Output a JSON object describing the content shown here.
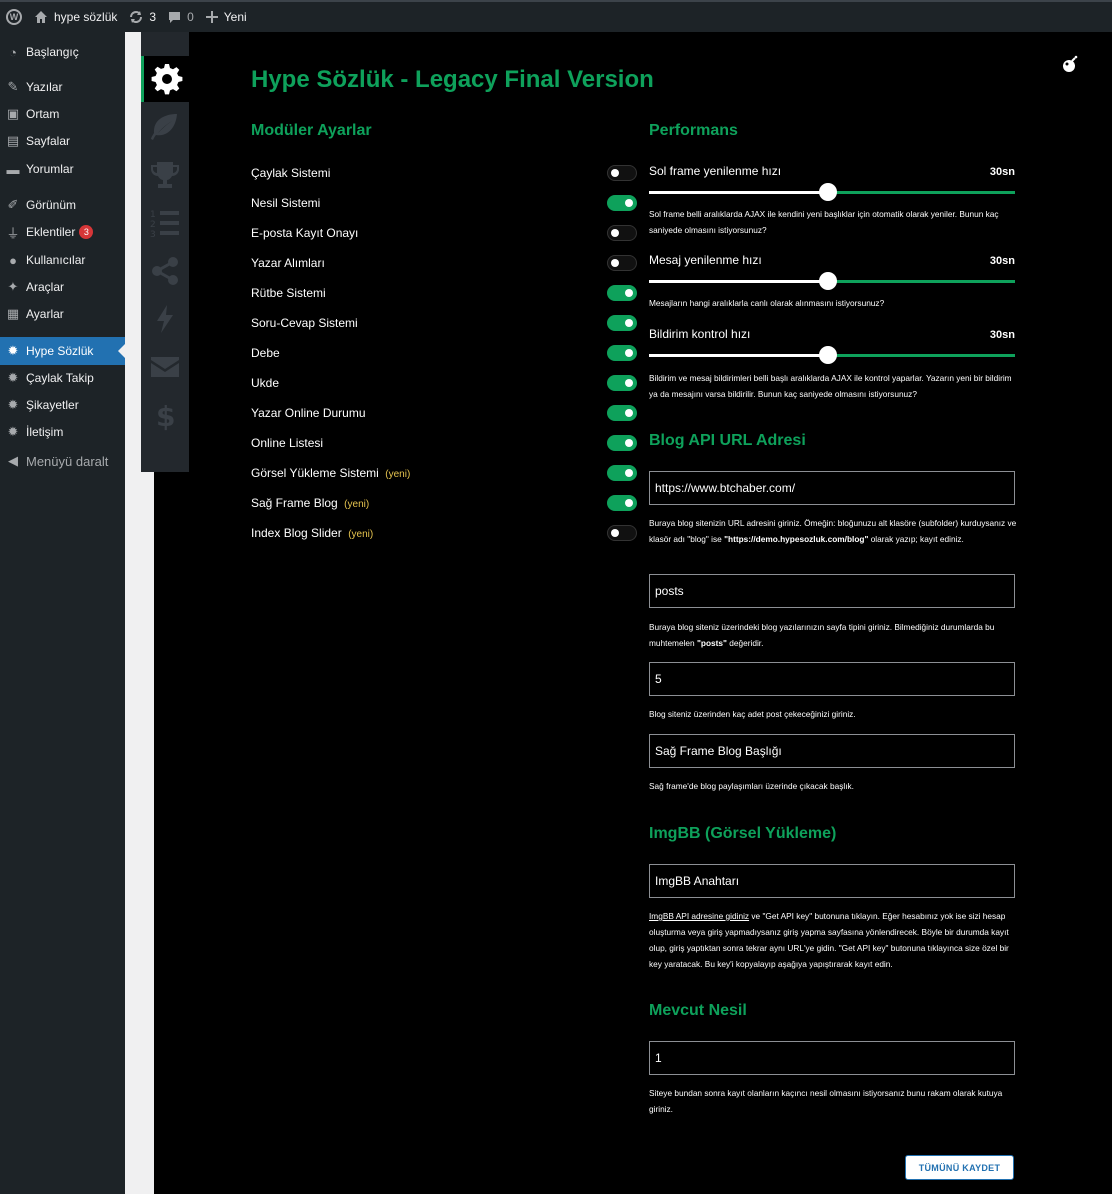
{
  "admin_bar": {
    "site_name": "hype sözlük",
    "updates_count": "3",
    "comments_count": "0",
    "new_label": "Yeni"
  },
  "admin_menu": {
    "items": [
      {
        "label": "Başlangıç",
        "icon": "dashboard-icon"
      },
      {
        "label": "Yazılar",
        "icon": "pin-icon"
      },
      {
        "label": "Ortam",
        "icon": "media-icon"
      },
      {
        "label": "Sayfalar",
        "icon": "page-icon"
      },
      {
        "label": "Yorumlar",
        "icon": "comment-icon"
      },
      {
        "label": "Görünüm",
        "icon": "brush-icon"
      },
      {
        "label": "Eklentiler",
        "icon": "plugin-icon",
        "badge": "3"
      },
      {
        "label": "Kullanıcılar",
        "icon": "user-icon"
      },
      {
        "label": "Araçlar",
        "icon": "wrench-icon"
      },
      {
        "label": "Ayarlar",
        "icon": "settings-icon"
      },
      {
        "label": "Hype Sözlük",
        "icon": "gear-icon",
        "active": true
      },
      {
        "label": "Çaylak Takip",
        "icon": "gear-icon"
      },
      {
        "label": "Şikayetler",
        "icon": "gear-icon"
      },
      {
        "label": "İletişim",
        "icon": "gear-icon"
      }
    ],
    "collapse_label": "Menüyü daralt"
  },
  "plugin_nav": {
    "items": [
      "gear-icon",
      "leaf-icon",
      "trophy-icon",
      "list-icon",
      "share-icon",
      "bolt-icon",
      "envelope-icon",
      "dollar-icon"
    ]
  },
  "page": {
    "title": "Hype Sözlük - Legacy Final Version"
  },
  "modules": {
    "section_title": "Modüler Ayarlar",
    "new_tag": "(yeni)",
    "items": [
      {
        "label": "Çaylak Sistemi",
        "on": false
      },
      {
        "label": "Nesil Sistemi",
        "on": true
      },
      {
        "label": "E-posta Kayıt Onayı",
        "on": false
      },
      {
        "label": "Yazar Alımları",
        "on": false
      },
      {
        "label": "Rütbe Sistemi",
        "on": true
      },
      {
        "label": "Soru-Cevap Sistemi",
        "on": true
      },
      {
        "label": "Debe",
        "on": true
      },
      {
        "label": "Ukde",
        "on": true
      },
      {
        "label": "Yazar Online Durumu",
        "on": true
      },
      {
        "label": "Online Listesi",
        "on": true
      },
      {
        "label": "Görsel Yükleme Sistemi",
        "on": true,
        "new": true
      },
      {
        "label": "Sağ Frame Blog",
        "on": true,
        "new": true
      },
      {
        "label": "Index Blog Slider",
        "on": false,
        "new": true
      }
    ]
  },
  "performance": {
    "section_title": "Performans",
    "sliders": [
      {
        "label": "Sol frame yenilenme hızı",
        "value": "30sn",
        "fraction": 0.49,
        "desc": "Sol frame belli aralıklarda AJAX ile kendini yeni başlıklar için otomatik olarak yeniler. Bunun kaç saniyede olmasını istiyorsunuz?"
      },
      {
        "label": "Mesaj yenilenme hızı",
        "value": "30sn",
        "fraction": 0.49,
        "desc": "Mesajların hangi aralıklarla canlı olarak alınmasını istiyorsunuz?"
      },
      {
        "label": "Bildirim kontrol hızı",
        "value": "30sn",
        "fraction": 0.49,
        "desc": "Bildirim ve mesaj bildirimleri belli başlı aralıklarda AJAX ile kontrol yaparlar. Yazarın yeni bir bildirim ya da mesajını varsa bildirilir. Bunun kaç saniyede olmasını istiyorsunuz?"
      }
    ]
  },
  "blog_api": {
    "section_title": "Blog API URL Adresi",
    "url_value": "https://www.btchaber.com/",
    "url_desc_1": "Buraya blog sitenizin URL adresini giriniz. Ömeğin: bloğunuzu alt klasöre (subfolder) kurduysanız ve klasör adı \"blog\" ise ",
    "url_desc_bold": "\"https://demo.hypesozluk.com/blog\"",
    "url_desc_2": " olarak yazıp; kayıt ediniz.",
    "post_type_value": "posts",
    "post_type_desc_1": "Buraya blog siteniz üzerindeki blog yazılarınızın sayfa tipini giriniz. Bilmediğiniz durumlarda bu muhtemelen ",
    "post_type_desc_bold": "\"posts\"",
    "post_type_desc_2": " değeridir.",
    "count_value": "5",
    "count_desc": "Blog siteniz üzerinden kaç adet post çekeceğinizi giriniz.",
    "title_value": "Sağ Frame Blog Başlığı",
    "title_desc": "Sağ frame'de blog paylaşımları üzerinde çıkacak başlık."
  },
  "imgbb": {
    "section_title": "ImgBB (Görsel Yükleme)",
    "key_value": "ImgBB Anahtarı",
    "link_text": "ImgBB API adresine gidiniz",
    "desc": " ve \"Get API key\" butonuna tıklayın. Eğer hesabınız yok ise sizi hesap oluşturma veya giriş yapmadıysanız giriş yapma sayfasına yönlendirecek. Böyle bir durumda kayıt olup, giriş yaptıktan sonra tekrar aynı URL'ye gidin. \"Get API key\" butonuna tıklayınca size özel bir key yaratacak. Bu key'i kopyalayıp aşağıya yapıştırarak kayıt edin."
  },
  "generation": {
    "section_title": "Mevcut Nesil",
    "value": "1",
    "desc": "Siteye bundan sonra kayıt olanların kaçıncı nesil olmasını istiyorsanız bunu rakam olarak kutuya giriniz."
  },
  "actions": {
    "save_label": "TÜMÜNÜ KAYDET"
  },
  "colors": {
    "accent": "#0ea15b",
    "wp_blue": "#2271b1",
    "new_tag": "#e6c44f"
  }
}
